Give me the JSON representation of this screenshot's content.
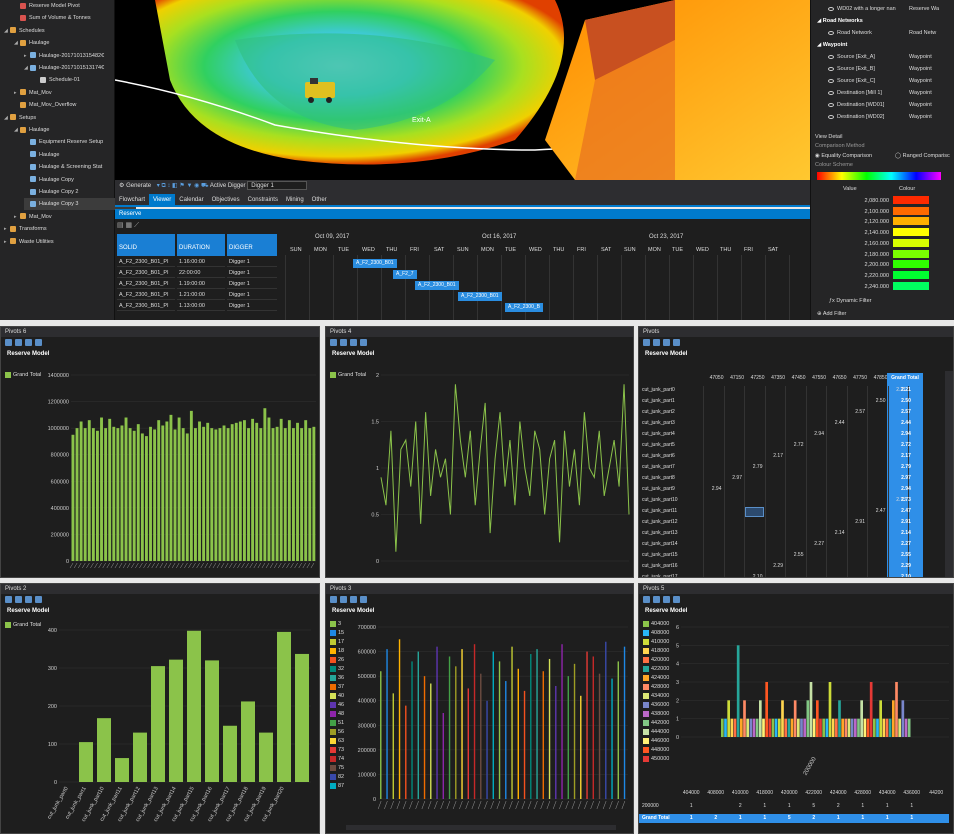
{
  "tree": {
    "items": [
      {
        "label": "Reserve Model Pivot",
        "indent": 1,
        "toggle": "",
        "color": "#d9534f"
      },
      {
        "label": "Sum of Volume & Tonnes",
        "indent": 1,
        "toggle": "",
        "color": "#d9534f"
      },
      {
        "label": "Schedules",
        "indent": 0,
        "toggle": "◢",
        "color": "#e0a040"
      },
      {
        "label": "Haulage",
        "indent": 1,
        "toggle": "◢",
        "color": "#e0a040"
      },
      {
        "label": "Haulage-2017101315482€",
        "indent": 2,
        "toggle": "▸",
        "color": "#7ab0e0"
      },
      {
        "label": "Haulage-2017101513174€",
        "indent": 2,
        "toggle": "◢",
        "color": "#7ab0e0"
      },
      {
        "label": "Schedule-01",
        "indent": 3,
        "toggle": "",
        "color": "#cccccc"
      },
      {
        "label": "Mat_Mov",
        "indent": 1,
        "toggle": "▸",
        "color": "#e0a040"
      },
      {
        "label": "Mat_Mov_Overflow",
        "indent": 1,
        "toggle": "",
        "color": "#e0a040"
      },
      {
        "label": "Setups",
        "indent": 0,
        "toggle": "◢",
        "color": "#e0a040"
      },
      {
        "label": "Haulage",
        "indent": 1,
        "toggle": "◢",
        "color": "#e0a040"
      },
      {
        "label": "Equipment Reserve Setup",
        "indent": 2,
        "toggle": "",
        "color": "#7ab0e0"
      },
      {
        "label": "Haulage",
        "indent": 2,
        "toggle": "",
        "color": "#7ab0e0"
      },
      {
        "label": "Haulage & Screening Stat",
        "indent": 2,
        "toggle": "",
        "color": "#7ab0e0"
      },
      {
        "label": "Haulage Copy",
        "indent": 2,
        "toggle": "",
        "color": "#7ab0e0"
      },
      {
        "label": "Haulage Copy 2",
        "indent": 2,
        "toggle": "",
        "color": "#7ab0e0"
      },
      {
        "label": "Haulage Copy 3",
        "indent": 2,
        "toggle": "",
        "color": "#7ab0e0",
        "selected": true
      },
      {
        "label": "Mat_Mov",
        "indent": 1,
        "toggle": "▸",
        "color": "#e0a040"
      },
      {
        "label": "Transforms",
        "indent": 0,
        "toggle": "▸",
        "color": "#e0a040"
      },
      {
        "label": "Waste Utilities",
        "indent": 0,
        "toggle": "▸",
        "color": "#e0a040"
      }
    ]
  },
  "viewport": {
    "label": "Exit-A"
  },
  "rightpanel": {
    "rows": [
      {
        "name": "WD02 with a longer nan",
        "type": "Reserve Wa",
        "head": false
      },
      {
        "name": "Road Networks",
        "type": "",
        "head": true
      },
      {
        "name": "Road Network",
        "type": "Road Netw",
        "head": false
      },
      {
        "name": "Waypoint",
        "type": "",
        "head": true
      },
      {
        "name": "Source [Exit_A]",
        "type": "Waypoint",
        "head": false
      },
      {
        "name": "Source [Exit_B]",
        "type": "Waypoint",
        "head": false
      },
      {
        "name": "Source [Exit_C]",
        "type": "Waypoint",
        "head": false
      },
      {
        "name": "Destination [Mill 1]",
        "type": "Waypoint",
        "head": false
      },
      {
        "name": "Destination [WD01]",
        "type": "Waypoint",
        "head": false
      },
      {
        "name": "Destination [WD02]",
        "type": "Waypoint",
        "head": false
      }
    ],
    "view_detail": "View Detail",
    "comparison_method": "Comparison Method",
    "equality": "Equality Comparison",
    "ranged": "Ranged Comparisc",
    "colour_scheme": "Colour Scheme",
    "value_header": "Value",
    "colour_header": "Colour",
    "colour_rows": [
      {
        "value": "2,080.000",
        "color": "#ff2a00"
      },
      {
        "value": "2,100.000",
        "color": "#ff6a00"
      },
      {
        "value": "2,120.000",
        "color": "#ffb000"
      },
      {
        "value": "2,140.000",
        "color": "#ffff00"
      },
      {
        "value": "2,160.000",
        "color": "#d8ff00"
      },
      {
        "value": "2,180.000",
        "color": "#7aff00"
      },
      {
        "value": "2,200.000",
        "color": "#30ff00"
      },
      {
        "value": "2,220.000",
        "color": "#00ff30"
      },
      {
        "value": "2,240.000",
        "color": "#00ff60"
      }
    ],
    "dynamic_filter": "Dynamic Filter",
    "add_filter": "Add Filter"
  },
  "toolbar": {
    "generate": "Generate",
    "active_digger": "Active Digger",
    "digger_value": "Digger 1"
  },
  "tabs": [
    "Flowchart",
    "Viewer",
    "Calendar",
    "Objectives",
    "Constraints",
    "Mining",
    "Other"
  ],
  "active_tab": "Viewer",
  "reserve_label": "Reserve",
  "gantt": {
    "headers": [
      "SOLID",
      "DURATION",
      "DIGGER"
    ],
    "rows": [
      [
        "A_F2_2300_B01_PI",
        "1.16:00:00",
        "Digger 1"
      ],
      [
        "A_F2_2300_B01_PI",
        "22:00:00",
        "Digger 1"
      ],
      [
        "A_F2_2300_B01_PI",
        "1.19:00:00",
        "Digger 1"
      ],
      [
        "A_F2_2300_B01_PI",
        "1.21:00:00",
        "Digger 1"
      ],
      [
        "A_F2_2300_B01_PI",
        "1.13:00:00",
        "Digger 1"
      ]
    ],
    "weeks": [
      "Oct 09, 2017",
      "Oct 16, 2017",
      "Oct 23, 2017"
    ],
    "days": [
      "SUN",
      "MON",
      "TUE",
      "WED",
      "THU",
      "FRI",
      "SAT"
    ],
    "bars": [
      "A_F2_2300_B01",
      "A_F2_7",
      "A_F2_2300_B01",
      "A_F2_2300_B01",
      "A_F2_2300_B"
    ]
  },
  "pivot6": {
    "title": "Pivots 6",
    "model": "Reserve Model",
    "legend": "Grand Total",
    "chart_data": {
      "type": "bar",
      "ylim": [
        0,
        1400000
      ],
      "yticks": [
        "1400000",
        "1200000",
        "1000000",
        "800000",
        "600000",
        "400000",
        "200000",
        "0"
      ],
      "series": [
        {
          "name": "Grand Total",
          "values": [
            950000,
            1000000,
            1050000,
            1000000,
            1060000,
            1000000,
            980000,
            1080000,
            1000000,
            1070000,
            1010000,
            1000000,
            1020000,
            1080000,
            1000000,
            980000,
            1030000,
            960000,
            940000,
            1010000,
            990000,
            1060000,
            1020000,
            1050000,
            1100000,
            990000,
            1080000,
            1000000,
            960000,
            1130000,
            1000000,
            1050000,
            1010000,
            1040000,
            1000000,
            990000,
            1000000,
            1020000,
            1000000,
            1030000,
            1040000,
            1050000,
            1060000,
            1000000,
            1070000,
            1040000,
            1000000,
            1150000,
            1080000,
            1000000,
            1010000,
            1070000,
            1000000,
            1060000,
            1000000,
            1040000,
            1000000,
            1060000,
            1000000,
            1010000
          ]
        }
      ]
    }
  },
  "pivot4": {
    "title": "Pivots 4",
    "model": "Reserve Model",
    "legend": "Grand Total",
    "chart_data": {
      "type": "line",
      "ylim": [
        0,
        2
      ],
      "yticks": [
        "2",
        "1.5",
        "1",
        "0.5",
        "0"
      ],
      "series": [
        {
          "name": "Grand Total",
          "values": [
            0.9,
            0.6,
            1.4,
            0.1,
            1.2,
            1.3,
            0.8,
            1.5,
            0.4,
            1.6,
            0.7,
            1.2,
            0.9,
            1.1,
            0.5,
            1.9,
            1.3,
            0.9,
            1.4,
            0.6,
            1.2,
            1.7,
            0.3,
            1.1,
            1.6,
            0.8,
            1.3,
            0.6,
            1.5,
            1.0,
            0.7,
            1.4,
            1.2,
            0.5,
            1.1,
            1.3,
            0.2,
            1.4,
            0.8,
            1.2,
            0.6,
            1.6,
            1.0,
            0.9,
            1.4,
            0.7,
            1.0,
            1.3,
            0.8,
            1.9,
            0.5
          ]
        }
      ]
    }
  },
  "pivots": {
    "title": "Pivots",
    "model": "Reserve Model",
    "cols": [
      "47050",
      "47150",
      "47250",
      "47350",
      "47450",
      "47550",
      "47650",
      "47750",
      "47850",
      "47950"
    ],
    "grand_total_label": "Grand Total",
    "rows": [
      {
        "label": "cut_junk_part0",
        "col": 9,
        "v": "2.21",
        "gt": "2.21"
      },
      {
        "label": "cut_junk_part1",
        "col": 8,
        "v": "2.50",
        "gt": "2.50"
      },
      {
        "label": "cut_junk_part2",
        "col": 7,
        "v": "2.57",
        "gt": "2.57"
      },
      {
        "label": "cut_junk_part3",
        "col": 6,
        "v": "2.44",
        "gt": "2.44"
      },
      {
        "label": "cut_junk_part4",
        "col": 5,
        "v": "2.94",
        "gt": "2.94"
      },
      {
        "label": "cut_junk_part5",
        "col": 4,
        "v": "2.72",
        "gt": "2.72"
      },
      {
        "label": "cut_junk_part6",
        "col": 3,
        "v": "2.17",
        "gt": "2.17"
      },
      {
        "label": "cut_junk_part7",
        "col": 2,
        "v": "2.79",
        "gt": "2.79"
      },
      {
        "label": "cut_junk_part8",
        "col": 1,
        "v": "2.97",
        "gt": "2.97"
      },
      {
        "label": "cut_junk_part9",
        "col": 0,
        "v": "2.94",
        "gt": "2.94"
      },
      {
        "label": "cut_junk_part10",
        "col": 9,
        "v": "2.73",
        "gt": "2.73"
      },
      {
        "label": "cut_junk_part11",
        "col": 8,
        "v": "2.47",
        "gt": "2.47"
      },
      {
        "label": "cut_junk_part12",
        "col": 7,
        "v": "2.91",
        "gt": "2.91"
      },
      {
        "label": "cut_junk_part13",
        "col": 6,
        "v": "2.14",
        "gt": "2.14"
      },
      {
        "label": "cut_junk_part14",
        "col": 5,
        "v": "2.27",
        "gt": "2.27"
      },
      {
        "label": "cut_junk_part15",
        "col": 4,
        "v": "2.55",
        "gt": "2.55"
      },
      {
        "label": "cut_junk_part16",
        "col": 3,
        "v": "2.29",
        "gt": "2.29"
      },
      {
        "label": "cut_junk_part17",
        "col": 2,
        "v": "2.10",
        "gt": "2.10"
      }
    ]
  },
  "pivot2": {
    "title": "Pivots 2",
    "model": "Reserve Model",
    "legend": "Grand Total",
    "chart_data": {
      "type": "bar",
      "ylim": [
        0,
        400
      ],
      "yticks": [
        "400",
        "300",
        "200",
        "100",
        "0"
      ],
      "categories": [
        "cut_junk_part0",
        "cut_junk_part1",
        "cut_junk_part10",
        "cut_junk_part11",
        "cut_junk_part12",
        "cut_junk_part13",
        "cut_junk_part14",
        "cut_junk_part15",
        "cut_junk_part16",
        "cut_junk_part17",
        "cut_junk_part18",
        "cut_junk_part19",
        "cut_junk_part20"
      ],
      "series": [
        {
          "name": "Grand Total",
          "values": [
            0,
            105,
            168,
            63,
            130,
            305,
            322,
            398,
            320,
            148,
            212,
            130,
            395,
            337
          ]
        }
      ]
    }
  },
  "pivot3": {
    "title": "Pivots 3",
    "model": "Reserve Model",
    "legend": [
      {
        "name": "3",
        "color": "#8bc34a"
      },
      {
        "name": "15",
        "color": "#1e88e5"
      },
      {
        "name": "17",
        "color": "#c0ca33"
      },
      {
        "name": "18",
        "color": "#ffb300"
      },
      {
        "name": "26",
        "color": "#f4511e"
      },
      {
        "name": "32",
        "color": "#00897b"
      },
      {
        "name": "36",
        "color": "#26a69a"
      },
      {
        "name": "37",
        "color": "#ef6c00"
      },
      {
        "name": "40",
        "color": "#d4e157"
      },
      {
        "name": "46",
        "color": "#5e35b1"
      },
      {
        "name": "48",
        "color": "#8e24aa"
      },
      {
        "name": "51",
        "color": "#43a047"
      },
      {
        "name": "56",
        "color": "#9e9d24"
      },
      {
        "name": "63",
        "color": "#fdd835"
      },
      {
        "name": "73",
        "color": "#e53935"
      },
      {
        "name": "74",
        "color": "#c62828"
      },
      {
        "name": "75",
        "color": "#6d4c41"
      },
      {
        "name": "82",
        "color": "#3949ab"
      },
      {
        "name": "87",
        "color": "#00acc1"
      }
    ],
    "chart_data": {
      "type": "bar",
      "ylim": [
        0,
        700000
      ],
      "yticks": [
        "700000",
        "600000",
        "500000",
        "400000",
        "300000",
        "200000",
        "100000",
        "0"
      ],
      "values": [
        520000,
        610000,
        430000,
        650000,
        380000,
        560000,
        600000,
        500000,
        470000,
        620000,
        350000,
        580000,
        540000,
        610000,
        450000,
        630000,
        510000,
        400000,
        600000,
        560000,
        480000,
        620000,
        530000,
        440000,
        590000,
        610000,
        520000,
        570000,
        460000,
        630000,
        500000,
        550000,
        420000,
        600000,
        580000,
        510000,
        640000,
        490000,
        560000,
        620000
      ]
    }
  },
  "pivot5": {
    "title": "Pivots 5",
    "model": "Reserve Model",
    "legend": [
      {
        "name": "404000",
        "color": "#8bc34a"
      },
      {
        "name": "408000",
        "color": "#29b6f6"
      },
      {
        "name": "410000",
        "color": "#cddc39"
      },
      {
        "name": "418000",
        "color": "#ffd54f"
      },
      {
        "name": "420000",
        "color": "#ff7043"
      },
      {
        "name": "422000",
        "color": "#26a69a"
      },
      {
        "name": "424000",
        "color": "#ffa726"
      },
      {
        "name": "428000",
        "color": "#ff8a65"
      },
      {
        "name": "434000",
        "color": "#dce775"
      },
      {
        "name": "436000",
        "color": "#7986cb"
      },
      {
        "name": "438000",
        "color": "#ba68c8"
      },
      {
        "name": "442000",
        "color": "#81c784"
      },
      {
        "name": "444000",
        "color": "#c5e1a5"
      },
      {
        "name": "446000",
        "color": "#fff176"
      },
      {
        "name": "448000",
        "color": "#ff5722"
      },
      {
        "name": "450000",
        "color": "#e53935"
      }
    ],
    "xlabel": "200000",
    "chart_data": {
      "type": "bar",
      "ylim": [
        0,
        6
      ],
      "yticks": [
        "6",
        "5",
        "4",
        "3",
        "2",
        "1",
        "0"
      ],
      "values": [
        1,
        1,
        2,
        1,
        1,
        5,
        1,
        2,
        1,
        1,
        1,
        1,
        2,
        1,
        3,
        1,
        1,
        1,
        1,
        2,
        1,
        1,
        1,
        2,
        1,
        1,
        1,
        2,
        3,
        1,
        2,
        1,
        1,
        1,
        3,
        1,
        1,
        2,
        1,
        1,
        1,
        1,
        1,
        1,
        2,
        1,
        1,
        3,
        1,
        1,
        2,
        1,
        1,
        1,
        2,
        3,
        1,
        2,
        1,
        1
      ]
    },
    "table": {
      "cols": [
        "404000",
        "408000",
        "410000",
        "418000",
        "420000",
        "422000",
        "424000",
        "428000",
        "434000",
        "436000",
        "44200"
      ],
      "row_label": "200000",
      "row": [
        "1",
        "",
        "2",
        "1",
        "1",
        "5",
        "2",
        "1",
        "1",
        "1",
        ""
      ],
      "gt_label": "Grand Total",
      "gt": [
        "1",
        "2",
        "1",
        "1",
        "5",
        "2",
        "1",
        "1",
        "1",
        "1",
        ""
      ]
    }
  }
}
